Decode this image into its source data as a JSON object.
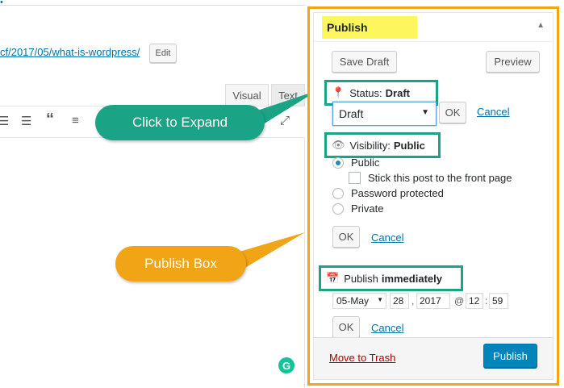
{
  "editor": {
    "permalink_text": "cf/2017/05/what-is-wordpress/",
    "edit_button": "Edit",
    "tab_visual": "Visual",
    "tab_text": "Text",
    "toolbar_icons": [
      "bulleted-list-icon",
      "numbered-list-icon",
      "blockquote-icon",
      "align-left-icon",
      "fullscreen-icon"
    ]
  },
  "callouts": {
    "expand": "Click to Expand",
    "publish_box": "Publish Box"
  },
  "publish": {
    "title": "Publish",
    "save_draft": "Save Draft",
    "preview": "Preview",
    "status_label": "Status:",
    "status_value": "Draft",
    "status_select": "Draft",
    "ok": "OK",
    "cancel": "Cancel",
    "visibility_label": "Visibility:",
    "visibility_value": "Public",
    "option_public": "Public",
    "option_sticky": "Stick this post to the front page",
    "option_password": "Password protected",
    "option_private": "Private",
    "publish_label": "Publish",
    "publish_value": "immediately",
    "month": "05-May",
    "day": "28",
    "year": "2017",
    "at": "@",
    "hour": "12",
    "colon": ":",
    "comma": ",",
    "minute": "59",
    "move_to_trash": "Move to Trash",
    "publish_button": "Publish"
  },
  "colors": {
    "highlight_yellow": "#fdf65c",
    "callout_green": "#1aa385",
    "callout_orange": "#f0a416",
    "primary_blue": "#0085ba",
    "trash_red": "#a00"
  }
}
